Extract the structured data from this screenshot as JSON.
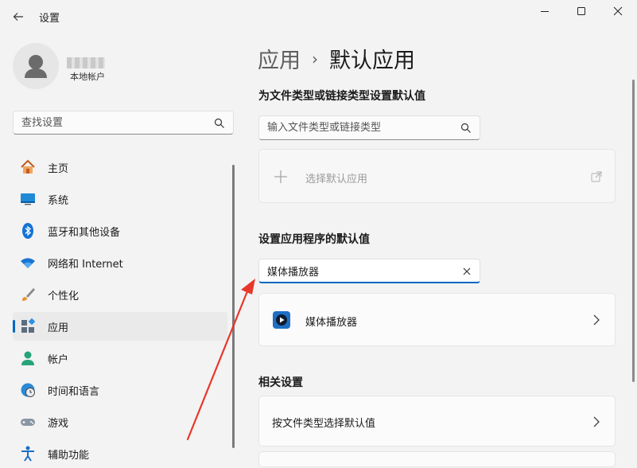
{
  "window": {
    "title": "设置",
    "controls": {
      "minimize": "minimize-icon",
      "maximize": "maximize-icon",
      "close": "close-icon"
    }
  },
  "profile": {
    "account_type": "本地帐户"
  },
  "sidebar": {
    "search_placeholder": "查找设置",
    "items": [
      {
        "label": "主页",
        "icon": "home-icon"
      },
      {
        "label": "系统",
        "icon": "system-icon"
      },
      {
        "label": "蓝牙和其他设备",
        "icon": "bluetooth-icon"
      },
      {
        "label": "网络和 Internet",
        "icon": "wifi-icon"
      },
      {
        "label": "个性化",
        "icon": "brush-icon"
      },
      {
        "label": "应用",
        "icon": "apps-icon",
        "active": true
      },
      {
        "label": "帐户",
        "icon": "account-icon"
      },
      {
        "label": "时间和语言",
        "icon": "clock-globe-icon"
      },
      {
        "label": "游戏",
        "icon": "gamepad-icon"
      },
      {
        "label": "辅助功能",
        "icon": "accessibility-icon"
      }
    ]
  },
  "breadcrumb": {
    "parent": "应用",
    "separator": "›",
    "current": "默认应用"
  },
  "file_types": {
    "heading": "为文件类型或链接类型设置默认值",
    "search_placeholder": "输入文件类型或链接类型",
    "choose_default_label": "选择默认应用"
  },
  "app_defaults": {
    "heading": "设置应用程序的默认值",
    "search_value": "媒体播放器",
    "result_label": "媒体播放器"
  },
  "related": {
    "heading": "相关设置",
    "item_label": "按文件类型选择默认值"
  },
  "colors": {
    "accent": "#0067c0",
    "annotation_arrow": "#e8372b"
  }
}
